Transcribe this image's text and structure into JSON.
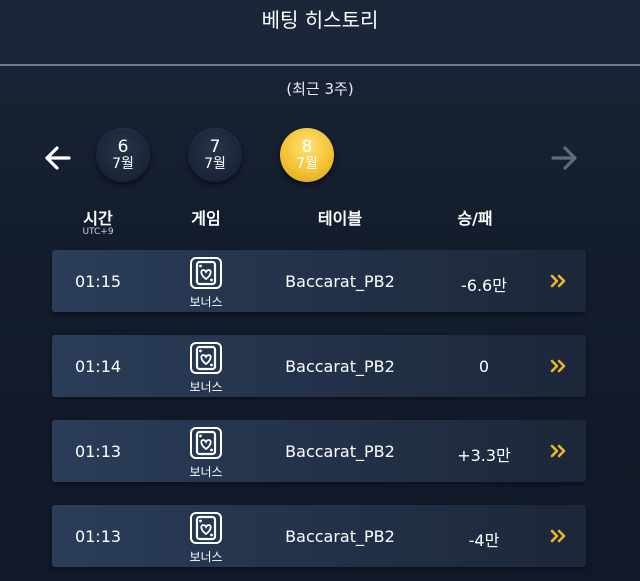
{
  "header": {
    "title": "베팅 히스토리"
  },
  "subtitle": "(최근 3주)",
  "weeks": [
    {
      "week": "6",
      "month": "7월",
      "active": false
    },
    {
      "week": "7",
      "month": "7월",
      "active": false
    },
    {
      "week": "8",
      "month": "7월",
      "active": true
    }
  ],
  "columns": {
    "time": "시간",
    "timezone": "UTC+9",
    "game": "게임",
    "table": "테이블",
    "result": "승/패"
  },
  "rows": [
    {
      "time": "01:15",
      "game_label": "보너스",
      "table": "Baccarat_PB2",
      "result": "-6.6만"
    },
    {
      "time": "01:14",
      "game_label": "보너스",
      "table": "Baccarat_PB2",
      "result": "0"
    },
    {
      "time": "01:13",
      "game_label": "보너스",
      "table": "Baccarat_PB2",
      "result": "+3.3만"
    },
    {
      "time": "01:13",
      "game_label": "보너스",
      "table": "Baccarat_PB2",
      "result": "-4만"
    }
  ],
  "icons": {
    "prev": "arrow-left-icon",
    "next": "arrow-right-icon",
    "game": "playing-card-heart-icon",
    "more": "double-chevron-right-icon"
  },
  "colors": {
    "accent_gold": "#f4c233",
    "chevron_gold": "#e7b92c",
    "disabled_arrow": "#5f6b7d"
  }
}
